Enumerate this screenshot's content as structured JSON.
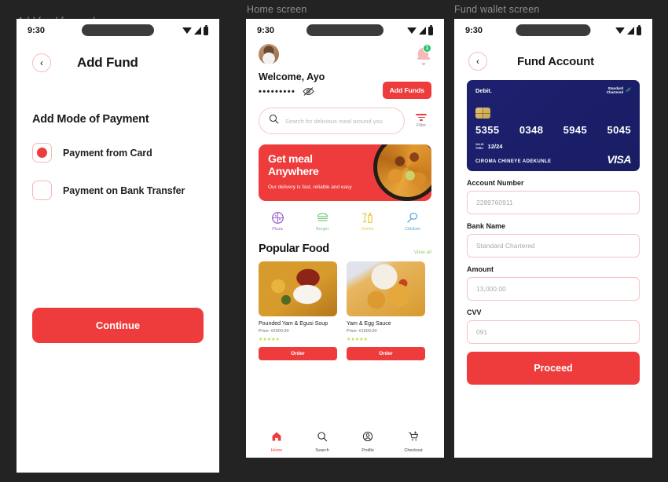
{
  "panels": {
    "left_label": "Add fund for card",
    "middle_label": "Home screen",
    "right_label": "Fund wallet screen"
  },
  "status_bar": {
    "time": "9:30"
  },
  "add_fund_screen": {
    "title": "Add Fund",
    "back_icon": "‹",
    "section_title": "Add Mode of Payment",
    "options": [
      {
        "label": "Payment from Card",
        "selected": true
      },
      {
        "label": "Payment on Bank Transfer",
        "selected": false
      }
    ],
    "continue_label": "Continue"
  },
  "home_screen": {
    "welcome": "Welcome, Ayo",
    "balance_masked": "•••••••••",
    "notification_count": "1",
    "add_funds_label": "Add Funds",
    "search_placeholder": "Search for delicious meal around you",
    "filter_label": "Filter",
    "promo": {
      "title_line1": "Get meal",
      "title_line2": "Anywhere",
      "subtitle": "Our delivery is fast, reliable and easy"
    },
    "categories": [
      {
        "label": "Pizza",
        "color": "#9b5fd0"
      },
      {
        "label": "Burger",
        "color": "#79c97f"
      },
      {
        "label": "Drinks",
        "color": "#e8c93f"
      },
      {
        "label": "Chicken",
        "color": "#4fa3de"
      }
    ],
    "popular_title": "Popular Food",
    "view_all": "View all",
    "foods": [
      {
        "name": "Pounded Yam & Egusi Soup",
        "price": "Price: #2000.00",
        "stars": "★★★★★",
        "order_label": "Order"
      },
      {
        "name": "Yam & Egg Sauce",
        "price": "Price: #1500.00",
        "stars": "★★★★★",
        "order_label": "Order"
      }
    ],
    "tabs": [
      {
        "label": "Home",
        "active": true
      },
      {
        "label": "Search",
        "active": false
      },
      {
        "label": "Profile",
        "active": false
      },
      {
        "label": "Checkout",
        "active": false
      }
    ]
  },
  "fund_wallet_screen": {
    "title": "Fund Account",
    "back_icon": "‹",
    "card": {
      "type_label": "Debit.",
      "bank_line1": "Standard",
      "bank_line2": "Chartered",
      "number_groups": [
        "5355",
        "0348",
        "5945",
        "5045"
      ],
      "valid_label_line1": "VALID",
      "valid_label_line2": "THRU",
      "valid_date": "12/24",
      "holder": "CIROMA CHINEYE ADEKUNLE",
      "network": "VISA"
    },
    "fields": [
      {
        "label": "Account Number",
        "value": "2289760911"
      },
      {
        "label": "Bank Name",
        "value": "Standard Chartered"
      },
      {
        "label": "Amount",
        "value": "13,000.00"
      },
      {
        "label": "CVV",
        "value": "091"
      }
    ],
    "proceed_label": "Proceed"
  },
  "colors": {
    "accent_red": "#ee3c3c",
    "pink_border": "#f5c4c4",
    "card_navy": "#1d2170",
    "badge_green": "#24c26a",
    "star_yellow": "#c3d844",
    "background": "#232323"
  }
}
